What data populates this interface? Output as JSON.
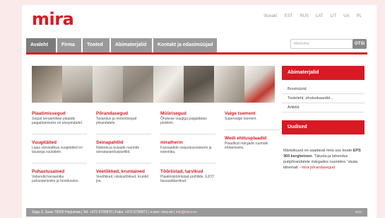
{
  "brand": {
    "logo": "mira",
    "accent": "#d71a24"
  },
  "languages": [
    "Slovakí",
    "EST",
    "RUS",
    "LAT",
    "LIT",
    "UA",
    "PL"
  ],
  "nav": {
    "tabs": [
      {
        "label": "Avaleht"
      },
      {
        "label": "Firma"
      },
      {
        "label": "Tooted"
      },
      {
        "label": "Abimaterjalid"
      },
      {
        "label": "Kontakt ja edasimüüjad"
      }
    ]
  },
  "search": {
    "placeholder": "Märksõne",
    "button": "OTSI"
  },
  "columns": [
    [
      {
        "title": "Plaatimissegud",
        "desc": "Segud keraamiliste plaatide paigaldamiseks eri aluspindadel."
      },
      {
        "title": "Vuugitäited",
        "desc": "Laias värvivalikus vuugitäited eri laiusega vuukidele."
      },
      {
        "title": "Puhastusained",
        "desc": "Vahendid keraamika puhastamiseks ja hoolduseks."
      }
    ],
    [
      {
        "title": "Põrandasegud",
        "desc": "Tasandus ja remontsegud põrandatele."
      },
      {
        "title": "Seinapahtlid",
        "desc": "Niisketa ja kuivade ruumide seinatasandusparttlid."
      },
      {
        "title": "Veetõkked, kruntained",
        "desc": "Veetõkked, niiskustõkked, kruntid jne."
      }
    ],
    [
      {
        "title": "Müürisegud",
        "desc": "Õhukese vuugiga paigaldatav plokiliim."
      },
      {
        "title": "miratherm",
        "desc": "Fassaadide soojustussüsteem ja esteetika."
      },
      {
        "title": "Tööriistad, tarvikud",
        "desc": "Plaatimistööriistad profiilide, EJOT fassaaditarvikud."
      }
    ],
    [
      {
        "title": "Valge tsement",
        "desc": "Supervalge tsement."
      },
      {
        "title": "Wedi ehitusplaadid",
        "desc": "Plaaditud märgade ruumide ehitamiseks."
      }
    ]
  ],
  "sidebar": {
    "title": "Abimaterjalid",
    "items": [
      "Broshüürid",
      "Tooteleht, ohutuskaardid...",
      "Artiklid"
    ],
    "news_title": "Uudised",
    "news": {
      "t1": "Märtsikuust on saadaval mira uus toode",
      "t2": "EPS 360 kergbetoon",
      "t3": ". Täiusta ja lahendus puitpõrandatele märgades ruumides.",
      "t4": "Vaata lähemalt - ",
      "link": "mira põrandasegud"
    }
  },
  "footer": {
    "text": "Segu 3, Saue 76505 Harjumaa | Tel: +372 6790870 | Faks: +372 6790871 | e-pos: mira.ee |",
    "email": "info@mira.ee",
    "right": "EEE"
  }
}
